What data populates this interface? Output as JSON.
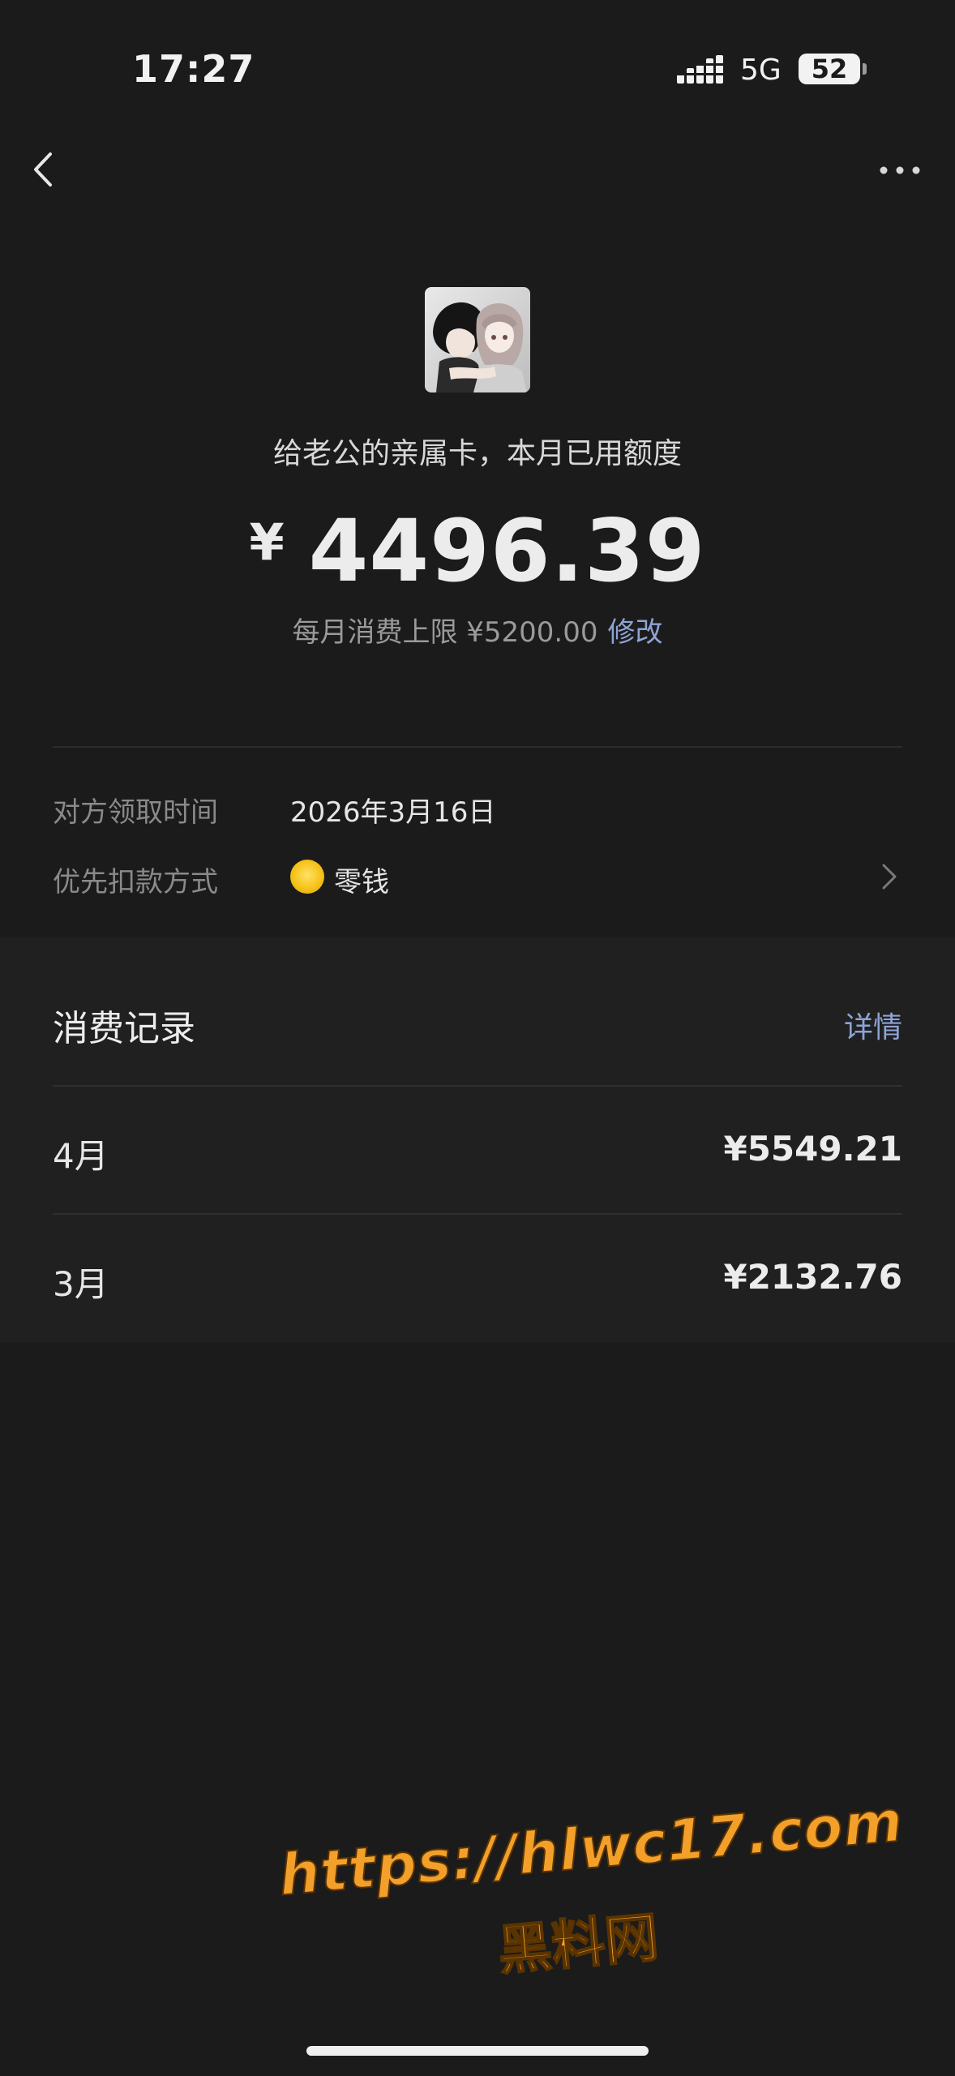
{
  "status_bar": {
    "time": "17:27",
    "network": "5G",
    "battery": "52"
  },
  "nav": {
    "back_icon": "chevron-left-icon",
    "more_icon": "more-horizontal-icon"
  },
  "header": {
    "title": "给老公的亲属卡，本月已用额度",
    "currency_symbol": "¥",
    "amount": "4496.39",
    "limit_text": "每月消费上限 ¥5200.00",
    "limit_edit_label": "修改"
  },
  "info": {
    "claim_time_label": "对方领取时间",
    "claim_time_value": "2026年3月16日",
    "payment_label": "优先扣款方式",
    "payment_value": "零钱",
    "payment_icon": "coin-icon"
  },
  "records": {
    "title": "消费记录",
    "detail_label": "详情",
    "items": [
      {
        "month": "4月",
        "amount": "¥5549.21"
      },
      {
        "month": "3月",
        "amount": "¥2132.76"
      }
    ]
  },
  "watermark": {
    "url": "https://hlwc17.com",
    "name": "黑料网"
  },
  "colors": {
    "background": "#1b1b1b",
    "panel": "#202020",
    "link": "#8ea4d6",
    "coin": "#f5c318",
    "watermark": "#f3a02b"
  }
}
